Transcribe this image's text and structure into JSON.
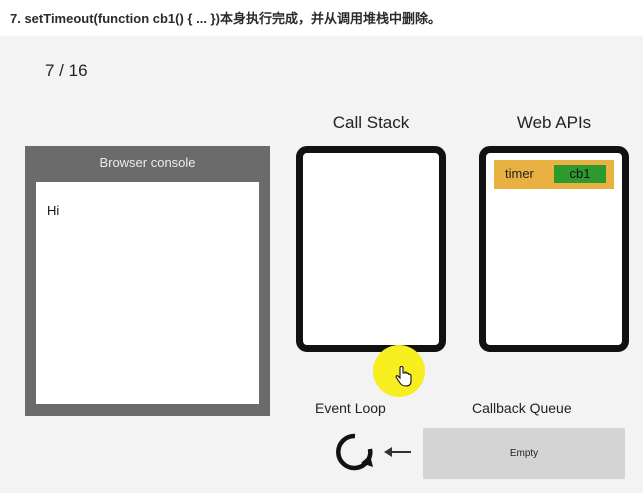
{
  "heading": "7. setTimeout(function cb1() { ... })本身执行完成，并从调用堆栈中删除。",
  "slide": {
    "counter": "7 / 16",
    "browser_console": {
      "title": "Browser console",
      "lines": [
        "Hi"
      ]
    },
    "call_stack": {
      "label": "Call Stack"
    },
    "web_apis": {
      "label": "Web APIs",
      "items": [
        {
          "name": "timer",
          "callback": "cb1"
        }
      ]
    },
    "event_loop": {
      "label": "Event Loop",
      "icon": "refresh-loop-icon"
    },
    "callback_queue": {
      "label": "Callback Queue",
      "content": "Empty"
    },
    "colors": {
      "console_frame": "#6b6b6b",
      "timer_item": "#e8b142",
      "callback_chip": "#2e9a2e",
      "cursor_highlight": "#f7ee1f",
      "queue_box": "#d4d4d4",
      "stack_marker": "#1e2fd6"
    }
  }
}
